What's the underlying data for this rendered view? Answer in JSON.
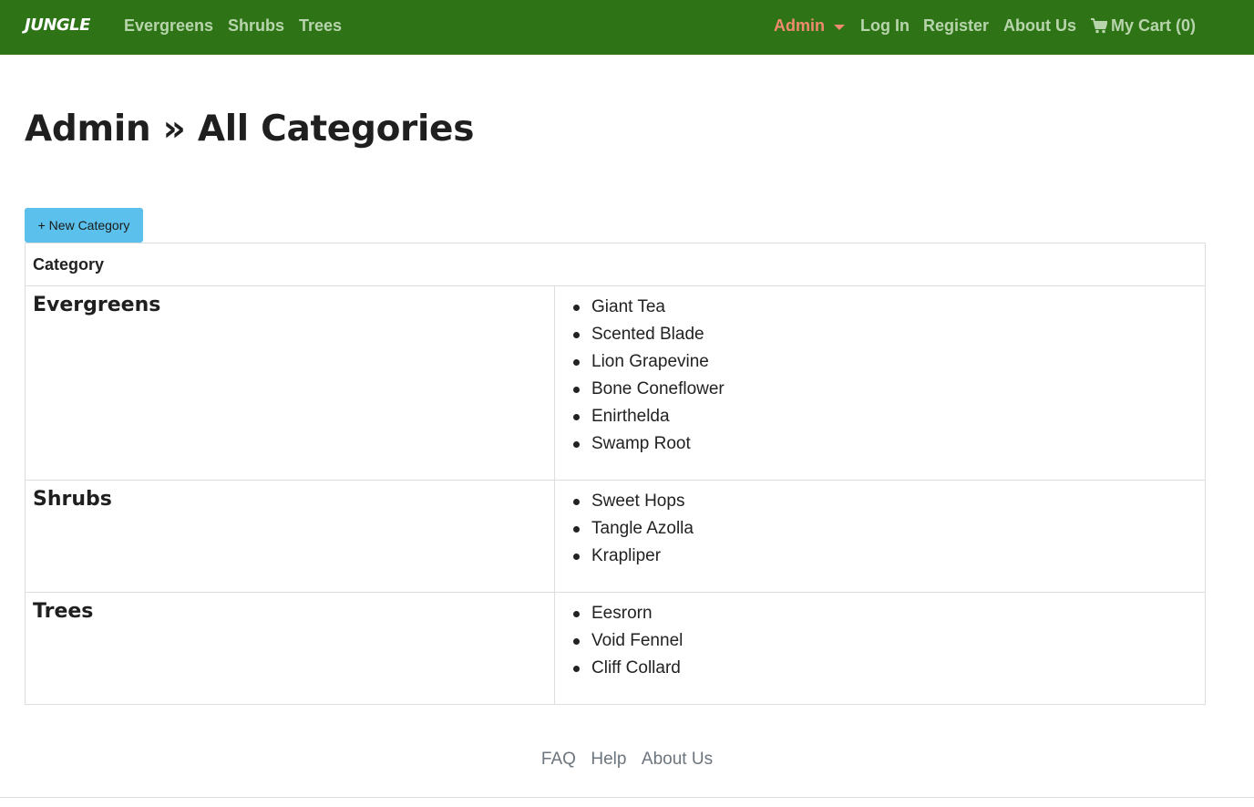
{
  "nav": {
    "brand": "JUNGLE",
    "left_links": [
      "Evergreens",
      "Shrubs",
      "Trees"
    ],
    "admin": "Admin",
    "login": "Log In",
    "register": "Register",
    "about": "About Us",
    "cart": "My Cart (0)",
    "cart_icon": "shopping-cart-icon"
  },
  "colors": {
    "navbar_bg": "#2e7417",
    "nav_link": "#b8d4ac",
    "admin_link": "#f08a6e",
    "button_bg": "#5bc0eb"
  },
  "page": {
    "title": "Admin » All Categories",
    "new_button": "+ New Category"
  },
  "table": {
    "header": "Category",
    "rows": [
      {
        "name": "Evergreens",
        "products": [
          "Giant Tea",
          "Scented Blade",
          "Lion Grapevine",
          "Bone Coneflower",
          "Enirthelda",
          "Swamp Root"
        ]
      },
      {
        "name": "Shrubs",
        "products": [
          "Sweet Hops",
          "Tangle Azolla",
          "Krapliper"
        ]
      },
      {
        "name": "Trees",
        "products": [
          "Eesrorn",
          "Void Fennel",
          "Cliff Collard"
        ]
      }
    ]
  },
  "footer": {
    "links": [
      "FAQ",
      "Help",
      "About Us"
    ]
  }
}
